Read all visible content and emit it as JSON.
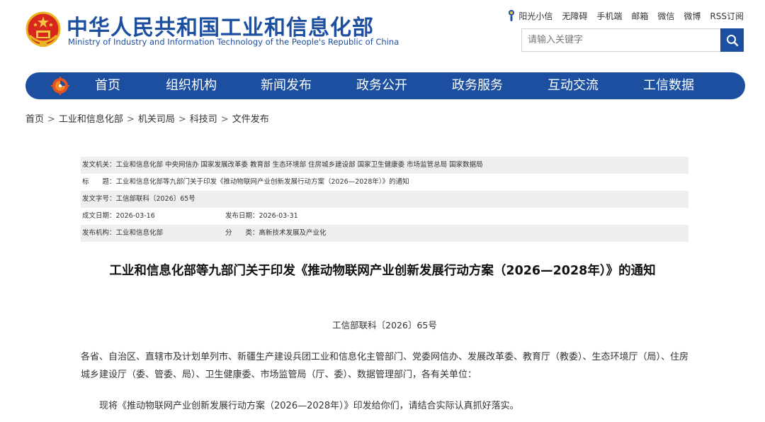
{
  "header": {
    "title_cn": "中华人民共和国工业和信息化部",
    "title_en": "Ministry of Industry and Information Technology of the People's Republic of China",
    "emblem_icon": "national-emblem-icon",
    "top_links": [
      "阳光小信",
      "无障碍",
      "手机端",
      "邮箱",
      "微信",
      "微博",
      "RSS订阅"
    ],
    "search_placeholder": "请输入关键字",
    "brand_color": "#1d4fa0",
    "emblem_color": "#d7261e"
  },
  "nav": {
    "items": [
      "首页",
      "组织机构",
      "新闻发布",
      "政务公开",
      "政务服务",
      "互动交流",
      "工信数据"
    ]
  },
  "breadcrumb": [
    "首页",
    "工业和信息化部",
    "机关司局",
    "科技司",
    "文件发布"
  ],
  "breadcrumb_separator": ">",
  "meta": {
    "issuer_label": "发文机关：",
    "issuer_value": "工业和信息化部 中央网信办 国家发展改革委 教育部 生态环境部 住房城乡建设部 国家卫生健康委 市场监管总局 国家数据局",
    "title_label": "标　　题：",
    "title_value": "工业和信息化部等九部门关于印发《推动物联网产业创新发展行动方案（2026—2028年）》的通知",
    "doc_no_label": "发文字号：",
    "doc_no_value": "工信部联科〔2026〕65号",
    "created_label": "成文日期：",
    "created_value": "2026-03-16",
    "published_label": "发布日期：",
    "published_value": "2026-03-31",
    "org_label": "发布机构：",
    "org_value": "工业和信息化部",
    "category_label": "分　　类：",
    "category_value": "高新技术发展及产业化"
  },
  "article": {
    "title": "工业和信息化部等九部门关于印发《推动物联网产业创新发展行动方案（2026—2028年）》的通知",
    "doc_number": "工信部联科〔2026〕65号",
    "para1": "各省、自治区、直辖市及计划单列市、新疆生产建设兵团工业和信息化主管部门、党委网信办、发展改革委、教育厅（教委）、生态环境厅（局）、住房城乡建设厅（委、管委、局）、卫生健康委、市场监管局（厅、委）、数据管理部门，各有关单位：",
    "para2": "现将《推动物联网产业创新发展行动方案（2026—2028年）》印发给你们，请结合实际认真抓好落实。"
  }
}
